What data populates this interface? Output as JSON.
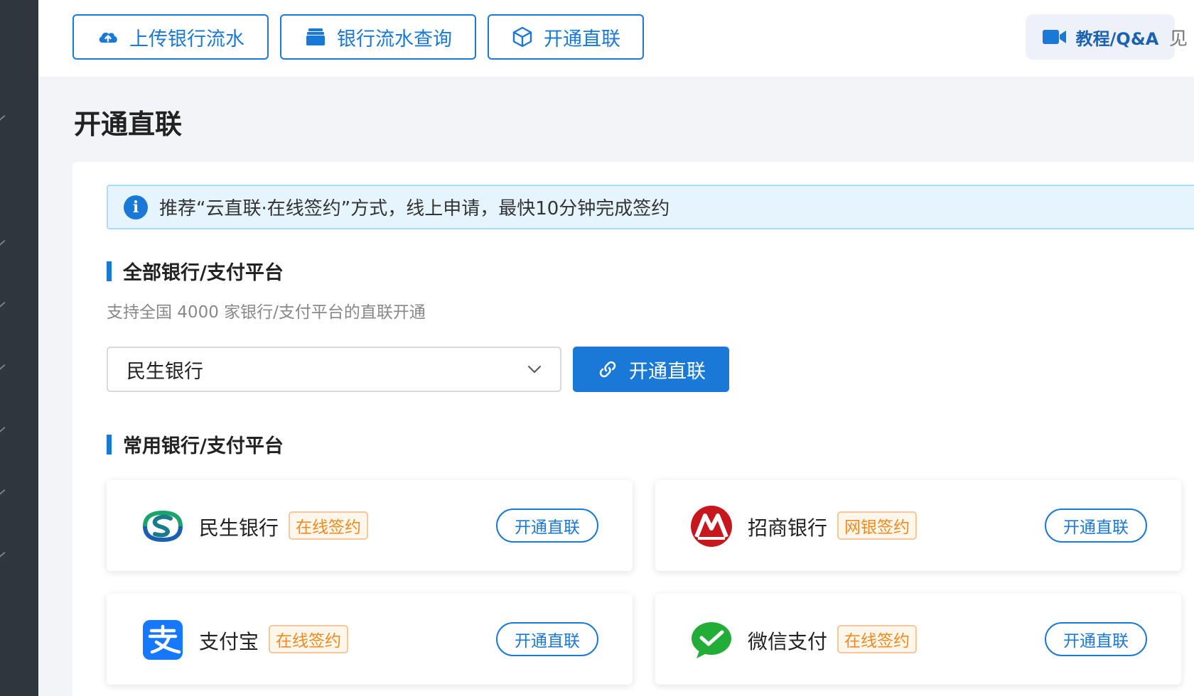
{
  "toolbar": {
    "upload_label": "上传银行流水",
    "query_label": "银行流水查询",
    "connect_label": "开通直联",
    "help_label": "教程/Q&A",
    "cut_text": "见"
  },
  "page": {
    "title": "开通直联"
  },
  "notice": {
    "text": "推荐“云直联·在线签约”方式，线上申请，最快10分钟完成签约"
  },
  "all_banks": {
    "heading": "全部银行/支付平台",
    "subtitle": "支持全国 4000 家银行/支付平台的直联开通",
    "selected_bank": "民生银行",
    "connect_label": "开通直联"
  },
  "common": {
    "heading": "常用银行/支付平台",
    "banks": [
      {
        "name": "民生银行",
        "tag": "在线签约",
        "action": "开通直联",
        "logo": "cmbc-logo"
      },
      {
        "name": "招商银行",
        "tag": "网银签约",
        "action": "开通直联",
        "logo": "cmb-logo"
      },
      {
        "name": "支付宝",
        "tag": "在线签约",
        "action": "开通直联",
        "logo": "alipay-logo"
      },
      {
        "name": "微信支付",
        "tag": "在线签约",
        "action": "开通直联",
        "logo": "wechat-pay-logo"
      }
    ]
  },
  "icons": {
    "upload": "cloud-upload-icon",
    "query": "stack-icon",
    "connect": "cube-icon",
    "help": "video-camera-icon",
    "info": "info-icon",
    "dropdown": "chevron-down-icon",
    "link": "link-icon"
  },
  "colors": {
    "primary": "#1a79d6",
    "tag_orange": "#f28a1c",
    "sidebar": "#30363d",
    "notice_bg": "#e6f5fd"
  }
}
